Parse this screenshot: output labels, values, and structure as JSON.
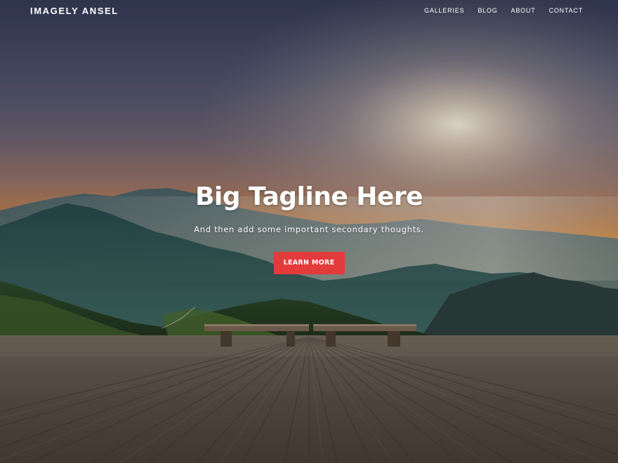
{
  "site": {
    "logo": "IMAGELY ANSEL"
  },
  "nav": {
    "items": [
      {
        "label": "GALLERIES"
      },
      {
        "label": "BLOG"
      },
      {
        "label": "ABOUT"
      },
      {
        "label": "CONTACT"
      }
    ]
  },
  "hero": {
    "tagline": "Big Tagline Here",
    "subtitle": "And then add some important secondary thoughts.",
    "cta_label": "LEARN MORE",
    "background": "mountain-sunset-boardwalk-photo"
  },
  "colors": {
    "cta": "#e33b3b",
    "text": "#ffffff"
  }
}
